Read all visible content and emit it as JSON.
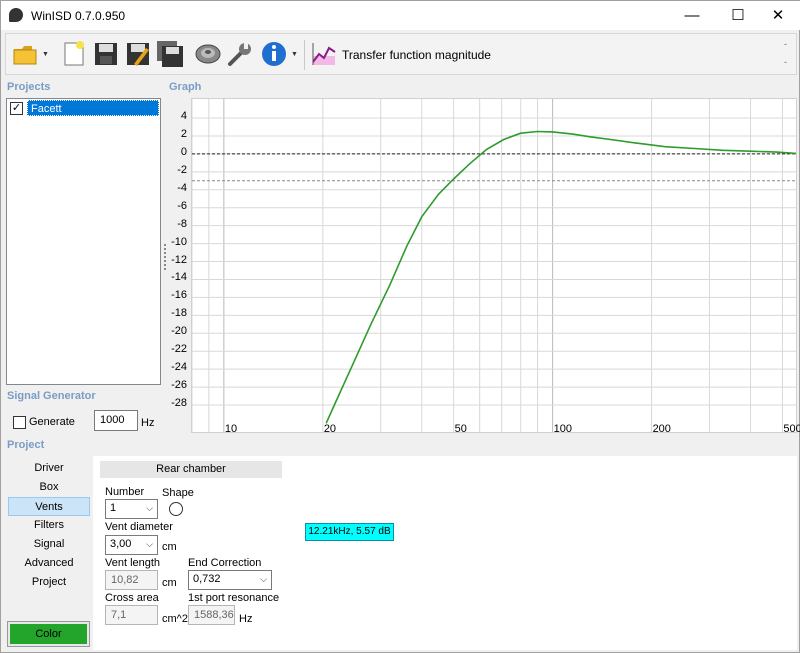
{
  "window": {
    "title": "WinISD 0.7.0.950",
    "min_glyph": "—",
    "max_glyph": "☐",
    "close_glyph": "✕"
  },
  "toolbar": {
    "icons": [
      "open-folder-icon",
      "new-document-icon",
      "save-icon",
      "save-edit-icon",
      "save-all-icon",
      "driver-speaker-icon",
      "wrench-icon",
      "info-icon",
      "chart-icon"
    ],
    "current_view": "Transfer function magnitude",
    "overflow_top": "-",
    "overflow_bottom": "-"
  },
  "sections": {
    "projects": "Projects",
    "graph": "Graph",
    "signal_generator": "Signal Generator",
    "project": "Project"
  },
  "projects": {
    "items": [
      {
        "name": "Facett",
        "checked": true
      }
    ]
  },
  "signal_generator": {
    "generate_label": "Generate",
    "frequency": "1000",
    "unit": "Hz",
    "checked": false
  },
  "nav": {
    "items": [
      "Driver",
      "Box",
      "Vents",
      "Filters",
      "Signal",
      "Advanced",
      "Project"
    ],
    "active": "Vents",
    "color_button": "Color"
  },
  "panel": {
    "header": "Rear chamber",
    "number_label": "Number",
    "number_value": "1",
    "shape_label": "Shape",
    "vent_diameter_label": "Vent diameter",
    "vent_diameter_value": "3,00",
    "vent_diameter_unit": "cm",
    "vent_length_label": "Vent length",
    "vent_length_value": "10,82",
    "vent_length_unit": "cm",
    "end_correction_label": "End Correction",
    "end_correction_value": "0,732",
    "cross_area_label": "Cross area",
    "cross_area_value": "7,1",
    "cross_area_unit": "cm^2",
    "port_resonance_label": "1st port resonance",
    "port_resonance_value": "1588,36",
    "port_resonance_unit": "Hz",
    "tooltip": "12.21kHz, 5.57 dB"
  },
  "chart_data": {
    "type": "line",
    "xscale": "log",
    "xlim": [
      8,
      550
    ],
    "ylim": [
      -30,
      5
    ],
    "x_ticks": [
      10,
      20,
      50,
      100,
      200,
      500
    ],
    "y_ticks": [
      4,
      2,
      0,
      -2,
      -4,
      -6,
      -8,
      -10,
      -12,
      -14,
      -16,
      -18,
      -20,
      -22,
      -24,
      -26,
      -28
    ],
    "reference_lines": [
      0,
      -3
    ],
    "grid": true,
    "line_color": "#2e9b2e",
    "series": [
      {
        "x": [
          20.5,
          22,
          25,
          28,
          32,
          36,
          40,
          45,
          50,
          56,
          63,
          71,
          80,
          90,
          100,
          115,
          130,
          150,
          180,
          220,
          270,
          330,
          400,
          480,
          550
        ],
        "y": [
          -30,
          -27.5,
          -23,
          -19,
          -14.6,
          -10.3,
          -7,
          -4.5,
          -2.8,
          -1.1,
          0.5,
          1.6,
          2.3,
          2.5,
          2.45,
          2.2,
          1.9,
          1.6,
          1.2,
          0.8,
          0.6,
          0.4,
          0.3,
          0.2,
          0.05
        ]
      }
    ]
  }
}
